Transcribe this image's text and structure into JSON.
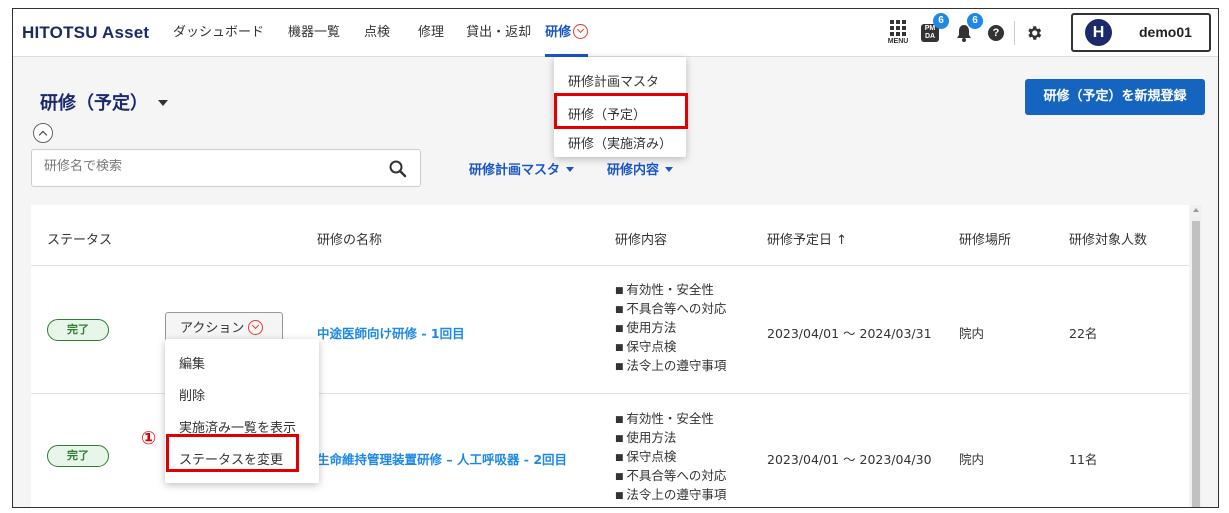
{
  "app": {
    "logo": "HITOTSU Asset",
    "nav": [
      "ダッシュボード",
      "機器一覧",
      "点検",
      "修理",
      "貸出・返却",
      "研修"
    ],
    "menu_label": "MENU",
    "pm_label": "PM\nDA",
    "pm_badge": "6",
    "bell_badge": "6",
    "help_label": "?",
    "avatar_initial": "H",
    "username": "demo01"
  },
  "training_menu": {
    "items": [
      "研修計画マスタ",
      "研修（予定）",
      "研修（実施済み）"
    ]
  },
  "page": {
    "title": "研修（予定）",
    "new_button": "研修（予定）を新規登録",
    "search_placeholder": "研修名で検索",
    "filters": [
      "研修計画マスタ",
      "研修内容"
    ]
  },
  "table": {
    "headers": [
      "ステータス",
      "研修の名称",
      "研修内容",
      "研修予定日 ↑",
      "研修場所",
      "研修対象人数"
    ],
    "action_label": "アクション",
    "rows": [
      {
        "status": "完了",
        "name": "中途医師向け研修 - 1回目",
        "contents": [
          "有効性・安全性",
          "不具合等への対応",
          "使用方法",
          "保守点検",
          "法令上の遵守事項"
        ],
        "date": "2023/04/01 ～ 2024/03/31",
        "place": "院内",
        "count": "22名"
      },
      {
        "status": "完了",
        "name": "生命維持管理装置研修 – 人工呼吸器 - 2回目",
        "contents": [
          "有効性・安全性",
          "使用方法",
          "保守点検",
          "不具合等への対応",
          "法令上の遵守事項"
        ],
        "date": "2023/04/01 ～ 2023/04/30",
        "place": "院内",
        "count": "11名"
      }
    ]
  },
  "action_menu": {
    "items": [
      "編集",
      "削除",
      "実施済み一覧を表示",
      "ステータスを変更"
    ],
    "step_marker": "①"
  },
  "colors": {
    "brand": "#1a2a6a",
    "link": "#1e88e5",
    "primary_button": "#1565c0",
    "highlight": "#e00000",
    "status_done": "#2e7d32"
  }
}
